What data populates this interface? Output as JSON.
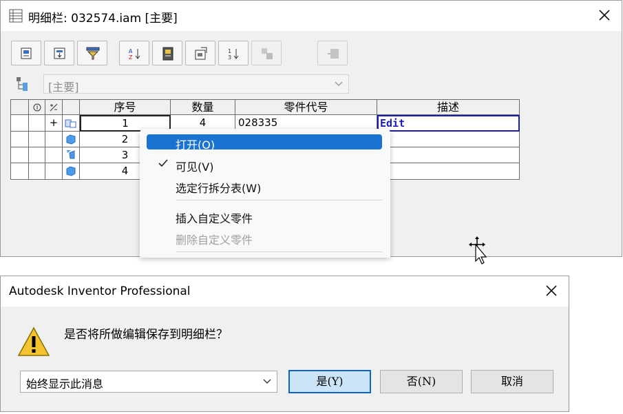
{
  "bom_window": {
    "title": "明细栏: 032574.iam [主要]",
    "view_select_value": "[主要]"
  },
  "grid": {
    "headers": {
      "seq": "序号",
      "qty": "数量",
      "part_no": "零件代号",
      "desc": "描述"
    },
    "rows": [
      {
        "expand": "+",
        "seq": "1",
        "qty": "4",
        "part_no": "028335",
        "desc": "Edit"
      },
      {
        "expand": "",
        "seq": "2",
        "qty": "",
        "part_no": "",
        "desc": ""
      },
      {
        "expand": "",
        "seq": "3",
        "qty": "",
        "part_no": "",
        "desc": ""
      },
      {
        "expand": "",
        "seq": "4",
        "qty": "",
        "part_no": "",
        "desc": ""
      }
    ]
  },
  "context_menu": {
    "items": [
      {
        "label": "打开(O)"
      },
      {
        "label": "可见(V)"
      },
      {
        "label": "选定行拆分表(W)"
      },
      {
        "label": "插入自定义零件"
      },
      {
        "label": "删除自定义零件"
      }
    ]
  },
  "dialog": {
    "title": "Autodesk Inventor Professional",
    "message": "是否将所做编辑保存到明细栏？",
    "select_value": "始终显示此消息",
    "yes_label": "是(Y)",
    "no_label": "否(N)",
    "cancel_label": "取消"
  },
  "colors": {
    "highlight": "#1a73d0",
    "edit_text": "#1a1ab8",
    "yes_border": "#0a64c8"
  }
}
